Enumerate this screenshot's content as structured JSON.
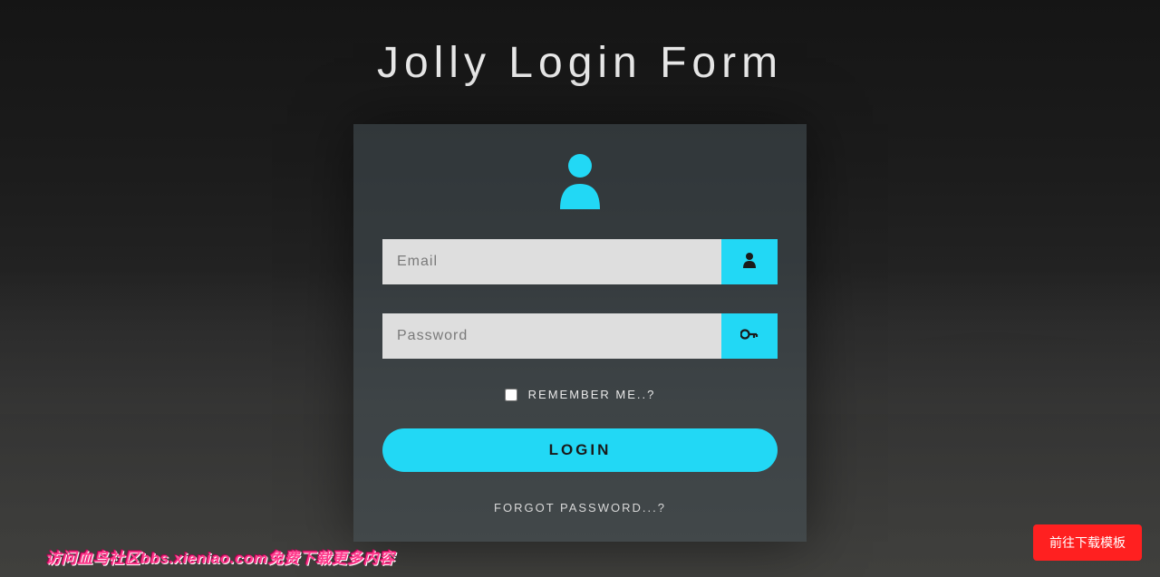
{
  "title": "Jolly Login Form",
  "form": {
    "email_placeholder": "Email",
    "password_placeholder": "Password",
    "remember_label": "REMEMBER ME..?",
    "login_button": "LOGIN",
    "forgot_password": "FORGOT PASSWORD...?"
  },
  "watermark_text": "访问血鸟社区bbs.xieniao.com免费下载更多内容",
  "download_button": "前往下载模板",
  "colors": {
    "accent": "#22d8f5",
    "danger": "#ff2020"
  }
}
